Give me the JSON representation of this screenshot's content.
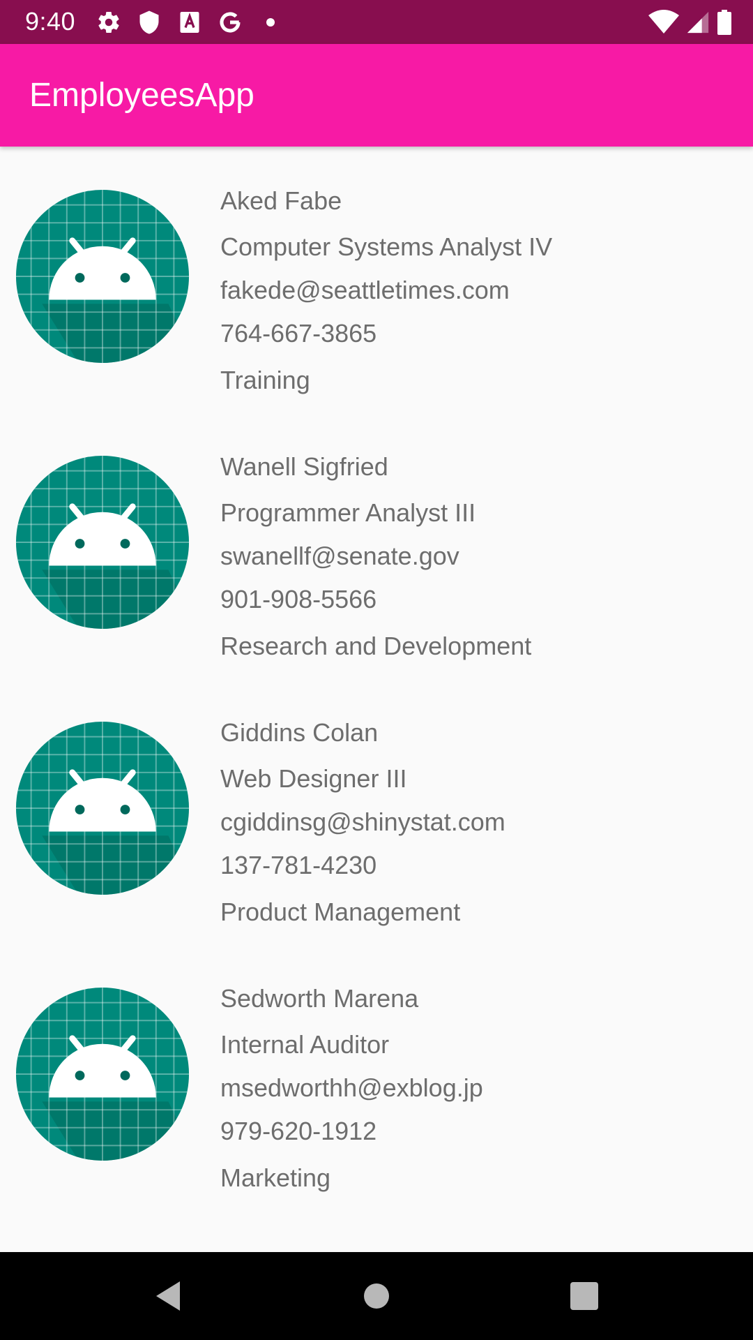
{
  "status_bar": {
    "time": "9:40",
    "left_icons": [
      "gear-icon",
      "shield-icon",
      "font-a-icon",
      "google-g-icon",
      "dot-icon"
    ],
    "right_icons": [
      "wifi-icon",
      "cellular-signal-icon",
      "battery-icon"
    ],
    "color": "#880e4f"
  },
  "app_bar": {
    "title": "EmployeesApp",
    "color": "#f71aa5"
  },
  "employees": [
    {
      "name": "Aked Fabe",
      "title": "Computer Systems Analyst IV",
      "email": "fakede@seattletimes.com",
      "phone": "764-667-3865",
      "department": "Training",
      "avatar_icon": "android-robot-icon"
    },
    {
      "name": "Wanell Sigfried",
      "title": "Programmer Analyst III",
      "email": "swanellf@senate.gov",
      "phone": "901-908-5566",
      "department": "Research and Development",
      "avatar_icon": "android-robot-icon"
    },
    {
      "name": "Giddins Colan",
      "title": "Web Designer III",
      "email": "cgiddinsg@shinystat.com",
      "phone": "137-781-4230",
      "department": "Product Management",
      "avatar_icon": "android-robot-icon"
    },
    {
      "name": "Sedworth Marena",
      "title": "Internal Auditor",
      "email": "msedworthh@exblog.jp",
      "phone": "979-620-1912",
      "department": "Marketing",
      "avatar_icon": "android-robot-icon"
    }
  ],
  "nav_bar": {
    "buttons": [
      "back-icon",
      "home-icon",
      "recents-icon"
    ]
  },
  "colors": {
    "avatar_background": "#00897b",
    "text": "#6d6d6d",
    "background": "#fafafa"
  }
}
